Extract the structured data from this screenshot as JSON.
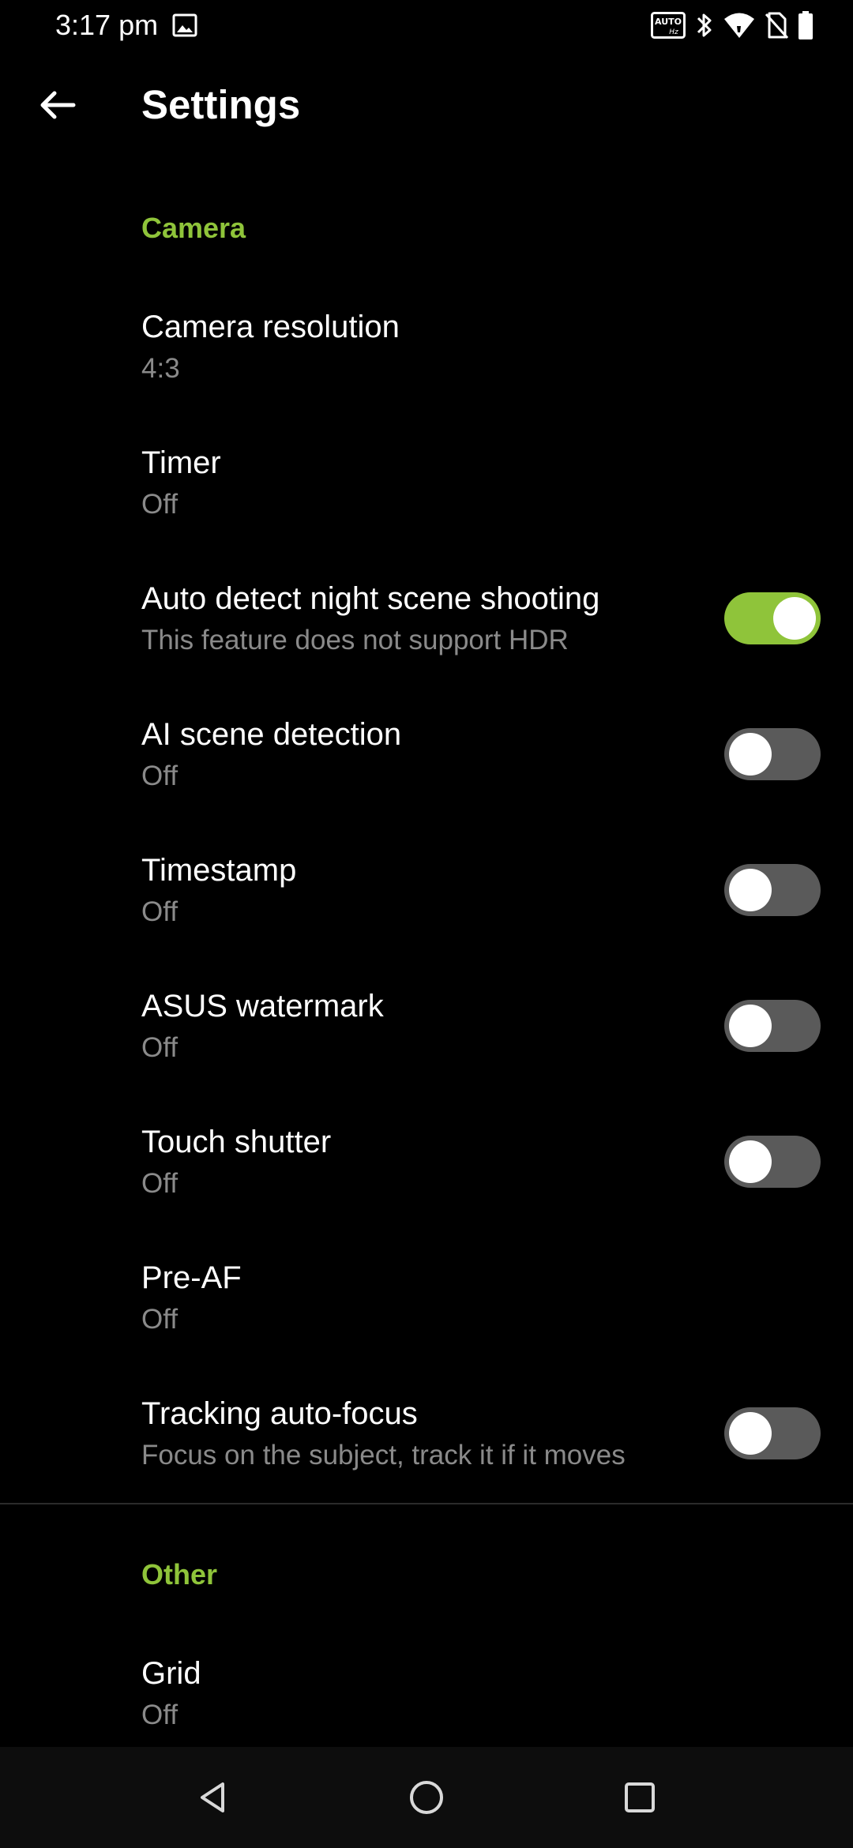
{
  "status_bar": {
    "time": "3:17 pm",
    "auto_hz_label": "AUTO",
    "auto_hz_sub": "Hz",
    "icons": [
      "gallery-icon",
      "auto-refresh-rate-icon",
      "bluetooth-icon",
      "wifi-icon",
      "no-sim-icon",
      "battery-icon"
    ]
  },
  "app_bar": {
    "title": "Settings"
  },
  "sections": {
    "camera": "Camera",
    "other": "Other"
  },
  "items": [
    {
      "title": "Camera resolution",
      "summary": "4:3",
      "toggle": null
    },
    {
      "title": "Timer",
      "summary": "Off",
      "toggle": null
    },
    {
      "title": "Auto detect night scene shooting",
      "summary": "This feature does not support HDR",
      "toggle": true
    },
    {
      "title": "AI scene detection",
      "summary": "Off",
      "toggle": false
    },
    {
      "title": "Timestamp",
      "summary": "Off",
      "toggle": false
    },
    {
      "title": "ASUS watermark",
      "summary": "Off",
      "toggle": false
    },
    {
      "title": "Touch shutter",
      "summary": "Off",
      "toggle": false
    },
    {
      "title": "Pre-AF",
      "summary": "Off",
      "toggle": null
    },
    {
      "title": "Tracking auto-focus",
      "summary": "Focus on the subject, track it if it moves",
      "toggle": false
    },
    {
      "title": "Grid",
      "summary": "Off",
      "toggle": null
    }
  ],
  "colors": {
    "accent": "#8fc43a",
    "background": "#000000",
    "summary_text": "#8a8a8a",
    "toggle_off": "#5a5a5a"
  },
  "nav_bar": {
    "icons": [
      "back-triangle-icon",
      "home-circle-icon",
      "recents-square-icon"
    ]
  }
}
